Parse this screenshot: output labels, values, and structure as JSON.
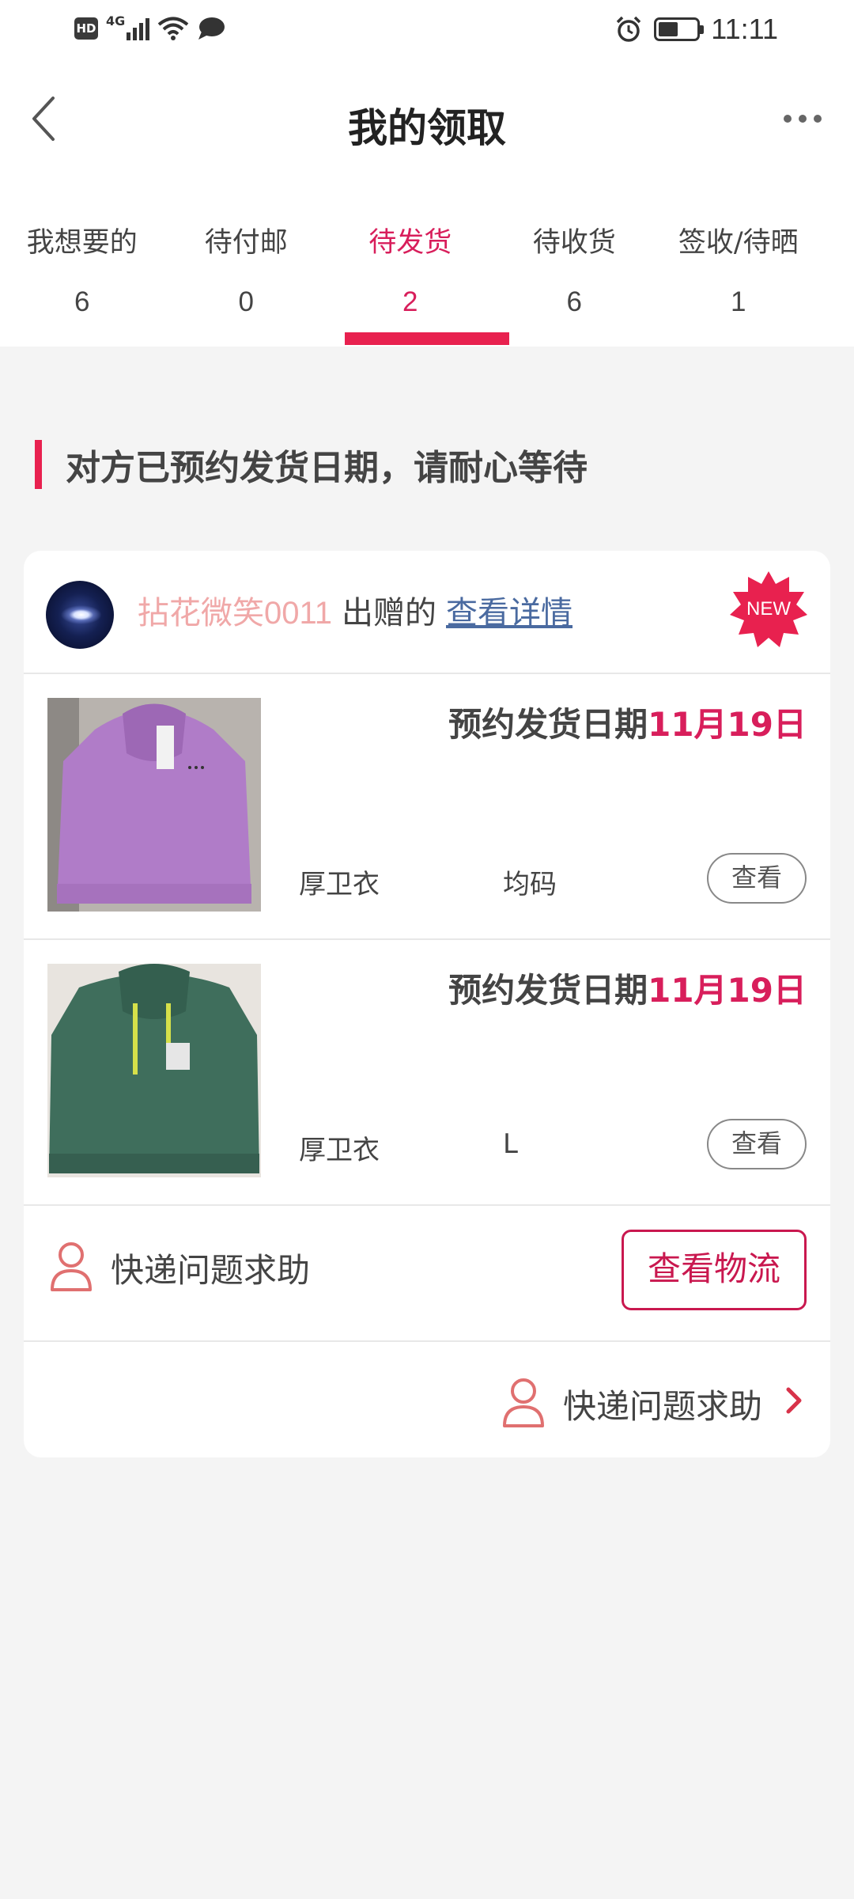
{
  "status_bar": {
    "hd": "HD",
    "network": "4G",
    "time": "11:11"
  },
  "header": {
    "title": "我的领取",
    "back_icon": "chevron-left-icon",
    "more_icon": "more-horizontal-icon"
  },
  "tabs": [
    {
      "label": "我想要的",
      "count": "6"
    },
    {
      "label": "待付邮",
      "count": "0"
    },
    {
      "label": "待发货",
      "count": "2",
      "active": true
    },
    {
      "label": "待收货",
      "count": "6"
    },
    {
      "label": "签收/待晒",
      "count": "1"
    }
  ],
  "section": {
    "heading": "对方已预约发货日期，请耐心等待"
  },
  "card": {
    "giver_name": "拈花微笑0011",
    "giver_suffix": "出赠的",
    "detail_link": "查看详情",
    "new_badge": "NEW",
    "items": [
      {
        "date_label": "预约发货日期",
        "date_value": "11月19日",
        "name": "厚卫衣",
        "size": "均码",
        "view_label": "查看",
        "photo": "purple hoodie"
      },
      {
        "date_label": "预约发货日期",
        "date_value": "11月19日",
        "name": "厚卫衣",
        "size": "L",
        "view_label": "查看",
        "photo": "green hoodie"
      }
    ],
    "help_label": "快递问题求助",
    "logistics_button": "查看物流",
    "footer_help_label": "快递问题求助"
  },
  "colors": {
    "accent": "#e8214f",
    "accent_text": "#d81e5b",
    "giver_name": "#f0a8a8",
    "link": "#4a6aa0",
    "background": "#f4f4f4"
  }
}
